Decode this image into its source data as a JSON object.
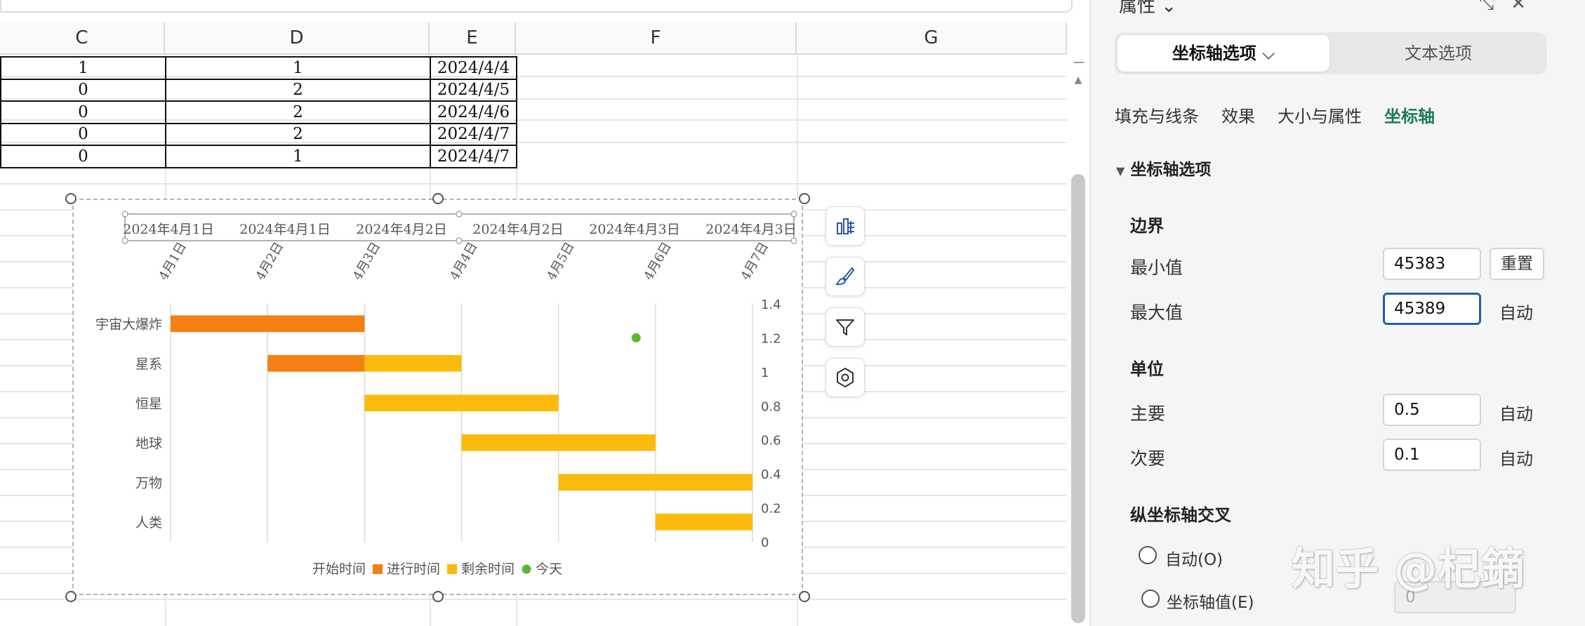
{
  "sheet": {
    "columns": [
      "C",
      "D",
      "E",
      "F",
      "G"
    ],
    "rows": [
      [
        "1",
        "1",
        "2024/4/4"
      ],
      [
        "0",
        "2",
        "2024/4/5"
      ],
      [
        "0",
        "2",
        "2024/4/6"
      ],
      [
        "0",
        "2",
        "2024/4/7"
      ],
      [
        "0",
        "1",
        "2024/4/7"
      ]
    ]
  },
  "chart_data": {
    "type": "bar",
    "orientation": "horizontal-gantt",
    "categories": [
      "宇宙大爆炸",
      "星系",
      "恒星",
      "地球",
      "万物",
      "人类"
    ],
    "top_axis_ticks": [
      "2024年4月1日",
      "2024年4月1日",
      "2024年4月2日",
      "2024年4月2日",
      "2024年4月3日",
      "2024年4月3日"
    ],
    "x_ticks": [
      "4月1日",
      "4月2日",
      "4月3日",
      "4月4日",
      "4月5日",
      "4月6日",
      "4月7日"
    ],
    "xlim": [
      0,
      6
    ],
    "secondary_y_ticks": [
      "1.4",
      "1.2",
      "1",
      "0.8",
      "0.6",
      "0.4",
      "0.2",
      "0"
    ],
    "secondary_ylim": [
      0,
      1.4
    ],
    "series": [
      {
        "name": "开始时间",
        "color": "none",
        "values": [
          0,
          1,
          2,
          3,
          4,
          5
        ]
      },
      {
        "name": "进行时间",
        "color": "#f47f12",
        "values": [
          2,
          1,
          0,
          0,
          0,
          0
        ]
      },
      {
        "name": "剩余时间",
        "color": "#fbbb0d",
        "values": [
          0,
          1,
          2,
          2,
          2,
          1
        ]
      }
    ],
    "today_marker": {
      "name": "今天",
      "color": "#5cb832",
      "x": 4.8,
      "y": 1.2
    },
    "grid": true,
    "legend": "bottom"
  },
  "chart_tools": {
    "icons": [
      "chart-elements-icon",
      "chart-style-icon",
      "chart-filter-icon",
      "chart-settings-icon"
    ]
  },
  "panel": {
    "title": "属性",
    "segments": {
      "axis": "坐标轴选项",
      "text": "文本选项"
    },
    "tabs": [
      "填充与线条",
      "效果",
      "大小与属性",
      "坐标轴"
    ],
    "section": "坐标轴选项",
    "bounds": {
      "heading": "边界",
      "min_label": "最小值",
      "min_value": "45383",
      "reset": "重置",
      "max_label": "最大值",
      "max_value": "45389",
      "max_auto": "自动"
    },
    "units": {
      "heading": "单位",
      "major_label": "主要",
      "major_value": "0.5",
      "major_auto": "自动",
      "minor_label": "次要",
      "minor_value": "0.1",
      "minor_auto": "自动"
    },
    "cross": {
      "heading": "纵坐标轴交叉",
      "auto_option": "自动(O)",
      "value_option": "坐标轴值(E)",
      "value_input": "0"
    }
  },
  "watermark": "知乎 @杞鏑"
}
